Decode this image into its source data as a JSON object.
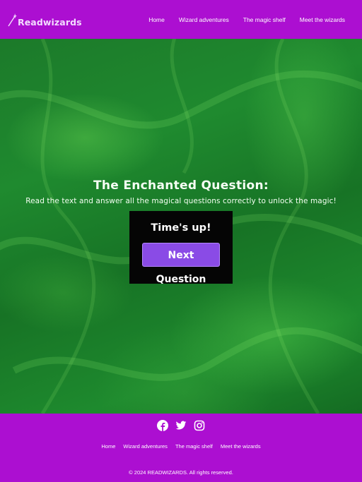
{
  "header": {
    "logo_text": "Readwizards",
    "nav": [
      "Home",
      "Wizard adventures",
      "The magic shelf",
      "Meet the wizards"
    ]
  },
  "hero": {
    "title": "The Enchanted Question:",
    "subtitle": "Read the text and answer all the magical questions correctly to unlock the magic!",
    "quiz": {
      "status": "Time's up!",
      "next_button": "Next Question"
    }
  },
  "footer": {
    "socials": [
      "facebook-icon",
      "twitter-icon",
      "instagram-icon"
    ],
    "nav": [
      "Home",
      "Wizard adventures",
      "The magic shelf",
      "Meet the wizards"
    ],
    "copyright": "© 2024 READWIZARDS. All rights reserved."
  },
  "colors": {
    "brand_purple": "#ac0fd1",
    "button_purple": "#8a4be6",
    "hero_green": "#1e8a2e"
  }
}
